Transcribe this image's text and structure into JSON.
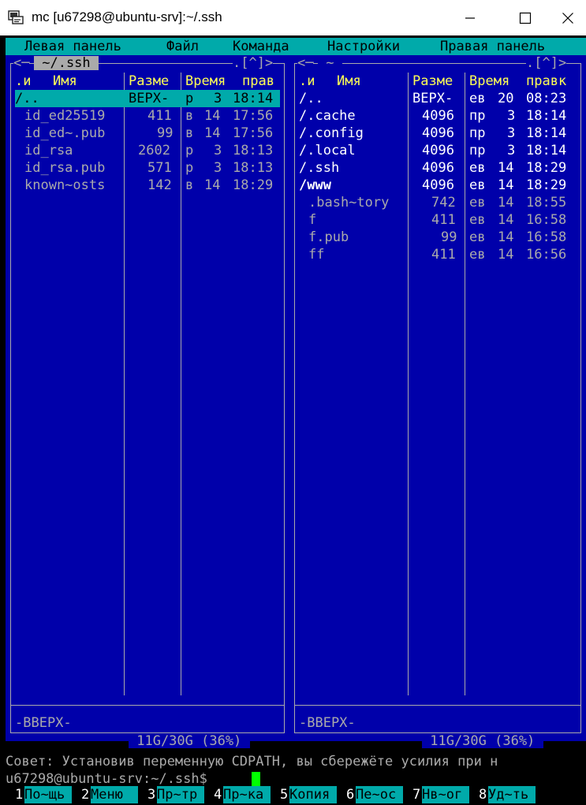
{
  "window": {
    "title": "mc [u67298@ubuntu-srv]:~/.ssh"
  },
  "menubar": {
    "items": [
      "Левая панель",
      "Файл",
      "Команда",
      "Настройки",
      "Правая панель"
    ]
  },
  "left_panel": {
    "path": " ~/.ssh ",
    "corner": ".[^]>",
    "arrow": "<─",
    "columns": [
      ".и",
      "Имя",
      "Разме",
      "Время",
      "прав"
    ],
    "rows": [
      {
        "name": "/..",
        "size": "ВЕРХ-",
        "month": "р",
        "day": "3",
        "time": "18:14",
        "selected": true
      },
      {
        "name": "id_ed25519",
        "size": "411",
        "month": "в",
        "day": "14",
        "time": "17:56"
      },
      {
        "name": "id_ed~.pub",
        "size": "99",
        "month": "в",
        "day": "14",
        "time": "17:56"
      },
      {
        "name": "id_rsa",
        "size": "2602",
        "month": "р",
        "day": "3",
        "time": "18:13"
      },
      {
        "name": "id_rsa.pub",
        "size": "571",
        "month": "р",
        "day": "3",
        "time": "18:13"
      },
      {
        "name": "known~osts",
        "size": "142",
        "month": "в",
        "day": "14",
        "time": "18:29"
      }
    ],
    "status": "-ВВЕРХ-",
    "disk": " 11G/30G (36%) "
  },
  "right_panel": {
    "path": " ~ ",
    "corner": ".[^]>",
    "arrow": "<─",
    "columns": [
      ".и",
      "Имя",
      "Разме",
      "Время",
      "правк"
    ],
    "rows": [
      {
        "name": "/..",
        "size": "ВЕРХ-",
        "month": "ев",
        "day": "20",
        "time": "08:23",
        "dir": true
      },
      {
        "name": "/.cache",
        "size": "4096",
        "month": "пр",
        "day": "3",
        "time": "18:14",
        "dir": true
      },
      {
        "name": "/.config",
        "size": "4096",
        "month": "пр",
        "day": "3",
        "time": "18:14",
        "dir": true
      },
      {
        "name": "/.local",
        "size": "4096",
        "month": "пр",
        "day": "3",
        "time": "18:14",
        "dir": true
      },
      {
        "name": "/.ssh",
        "size": "4096",
        "month": "ев",
        "day": "14",
        "time": "18:29",
        "dir": true
      },
      {
        "name": "/www",
        "size": "4096",
        "month": "ев",
        "day": "14",
        "time": "18:29",
        "dir": true
      },
      {
        "name": ".bash~tory",
        "size": "742",
        "month": "ев",
        "day": "14",
        "time": "18:55"
      },
      {
        "name": "f",
        "size": "411",
        "month": "ев",
        "day": "14",
        "time": "16:58"
      },
      {
        "name": "f.pub",
        "size": "99",
        "month": "ев",
        "day": "14",
        "time": "16:58"
      },
      {
        "name": "ff",
        "size": "411",
        "month": "ев",
        "day": "14",
        "time": "16:56"
      }
    ],
    "status": "-ВВЕРХ-",
    "disk": " 11G/30G (36%) "
  },
  "hint": "Совет: Установив переменную CDPATH, вы сбережёте усилия при н",
  "prompt": "u67298@ubuntu-srv:~/.ssh$ ",
  "fkeys": [
    {
      "num": "1",
      "label": "По~щь"
    },
    {
      "num": "2",
      "label": "Меню "
    },
    {
      "num": "3",
      "label": "Пр~тр"
    },
    {
      "num": "4",
      "label": "Пр~ка"
    },
    {
      "num": "5",
      "label": "Копия"
    },
    {
      "num": "6",
      "label": "Пе~ос"
    },
    {
      "num": "7",
      "label": "Нв~ог"
    },
    {
      "num": "8",
      "label": "Уд~ть"
    }
  ],
  "colors": {
    "panel_bg": "#0000aa",
    "menu_bg": "#00aaaa",
    "header_fg": "#ffff55",
    "cursor": "#00ff00"
  },
  "icons": {
    "app": "terminal-app-icon",
    "minimize": "minimize-icon",
    "maximize": "maximize-icon",
    "close": "close-icon"
  }
}
